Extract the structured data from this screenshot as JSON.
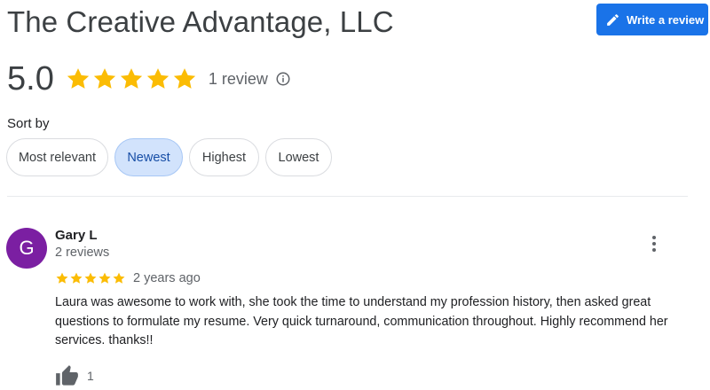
{
  "business": {
    "name": "The Creative Advantage, LLC"
  },
  "actions": {
    "write_review": "Write a review",
    "write_review_icon": "pencil-icon"
  },
  "summary": {
    "rating": "5.0",
    "stars": 5,
    "review_count": "1 review",
    "info_icon": "info-icon"
  },
  "sort": {
    "label": "Sort by",
    "options": [
      "Most relevant",
      "Newest",
      "Highest",
      "Lowest"
    ],
    "selected": "Newest"
  },
  "review": {
    "avatar_letter": "G",
    "reviewer": "Gary L",
    "reviewer_reviews": "2 reviews",
    "stars": 5,
    "time": "2 years ago",
    "text": "Laura was awesome to work with, she took the time to understand my profession history, then asked great questions to formulate my resume. Very quick turnaround, communication throughout. Highly recommend her services. thanks!!",
    "likes": "1",
    "like_icon": "thumbs-up-icon",
    "more_icon": "more-vert-icon"
  },
  "colors": {
    "accent": "#1a73e8",
    "star": "#fbbc04",
    "avatar": "#7b1fa2",
    "chip_active": "#d2e3fc"
  }
}
